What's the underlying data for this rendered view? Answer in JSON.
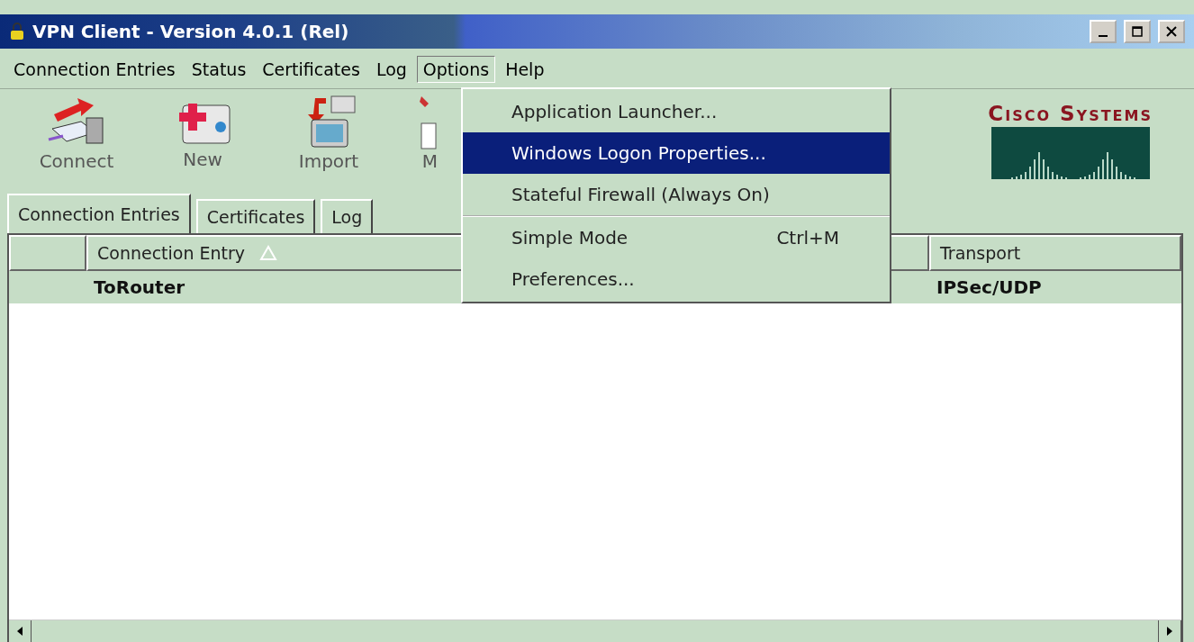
{
  "window": {
    "title": "VPN Client - Version 4.0.1 (Rel)"
  },
  "menu_bar": [
    {
      "label": "Connection Entries",
      "selected": false
    },
    {
      "label": "Status",
      "selected": false
    },
    {
      "label": "Certificates",
      "selected": false
    },
    {
      "label": "Log",
      "selected": false
    },
    {
      "label": "Options",
      "selected": true
    },
    {
      "label": "Help",
      "selected": false
    }
  ],
  "toolbar": [
    {
      "label": "Connect",
      "kind": "connect"
    },
    {
      "label": "New",
      "kind": "new"
    },
    {
      "label": "Import",
      "kind": "import"
    },
    {
      "label": "M",
      "kind": "modify"
    }
  ],
  "logo": {
    "text": "Cisco Systems"
  },
  "tabs": [
    {
      "label": "Connection Entries",
      "selected": true
    },
    {
      "label": "Certificates",
      "selected": false
    },
    {
      "label": "Log",
      "selected": false
    }
  ],
  "table": {
    "columns": [
      {},
      {
        "label": "Connection Entry",
        "sorted": true
      },
      {
        "label": "Transport"
      }
    ],
    "rows": [
      {
        "cells": [
          "",
          "ToRouter",
          "IPSec/UDP"
        ],
        "selected": true
      }
    ]
  },
  "options_menu": {
    "groups": [
      [
        {
          "label": "Application Launcher...",
          "selected": false
        },
        {
          "label": "Windows Logon Properties...",
          "selected": true
        },
        {
          "label": "Stateful Firewall (Always On)",
          "selected": false
        }
      ],
      [
        {
          "label": "Simple Mode",
          "shortcut": "Ctrl+M",
          "selected": false
        },
        {
          "label": "Preferences...",
          "selected": false
        }
      ]
    ]
  }
}
